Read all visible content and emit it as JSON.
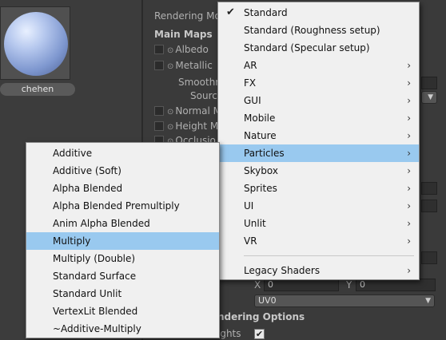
{
  "asset": {
    "name": "chehen"
  },
  "inspector": {
    "rendering_mode_label": "Rendering Mo",
    "main_maps_title": "Main Maps",
    "props": {
      "albedo": "Albedo",
      "metallic": "Metallic",
      "smoothness": "Smoothn",
      "source": "Sourc",
      "normal_map": "Normal M",
      "height_map": "Height M",
      "occlusion": "Occlusio"
    },
    "offset": {
      "x_label": "X",
      "x_value": "0",
      "y_label": "Y",
      "y_value": "0"
    },
    "uv_set": "UV0",
    "rendering_options_title": "ndering Options",
    "lights_label": "ights",
    "lights_checked": "✔"
  },
  "shader_menu": {
    "items": [
      {
        "label": "Standard",
        "checked": "✔",
        "arrow": ""
      },
      {
        "label": "Standard (Roughness setup)",
        "checked": "",
        "arrow": ""
      },
      {
        "label": "Standard (Specular setup)",
        "checked": "",
        "arrow": ""
      },
      {
        "label": "AR",
        "checked": "",
        "arrow": "›"
      },
      {
        "label": "FX",
        "checked": "",
        "arrow": "›"
      },
      {
        "label": "GUI",
        "checked": "",
        "arrow": "›"
      },
      {
        "label": "Mobile",
        "checked": "",
        "arrow": "›"
      },
      {
        "label": "Nature",
        "checked": "",
        "arrow": "›"
      },
      {
        "label": "Particles",
        "checked": "",
        "arrow": "›"
      },
      {
        "label": "Skybox",
        "checked": "",
        "arrow": "›"
      },
      {
        "label": "Sprites",
        "checked": "",
        "arrow": "›"
      },
      {
        "label": "UI",
        "checked": "",
        "arrow": "›"
      },
      {
        "label": "Unlit",
        "checked": "",
        "arrow": "›"
      },
      {
        "label": "VR",
        "checked": "",
        "arrow": "›"
      }
    ],
    "legacy": {
      "label": "Legacy Shaders",
      "arrow": "›"
    }
  },
  "particles_submenu": {
    "items": [
      {
        "label": "Additive"
      },
      {
        "label": "Additive (Soft)"
      },
      {
        "label": "Alpha Blended"
      },
      {
        "label": "Alpha Blended Premultiply"
      },
      {
        "label": "Anim Alpha Blended"
      },
      {
        "label": "Multiply"
      },
      {
        "label": "Multiply (Double)"
      },
      {
        "label": "Standard Surface"
      },
      {
        "label": "Standard Unlit"
      },
      {
        "label": "VertexLit Blended"
      },
      {
        "label": "~Additive-Multiply"
      }
    ]
  },
  "colors": {
    "highlight": "#99c9ef",
    "menu_bg": "#f0f0f0",
    "editor_bg": "#383838"
  }
}
